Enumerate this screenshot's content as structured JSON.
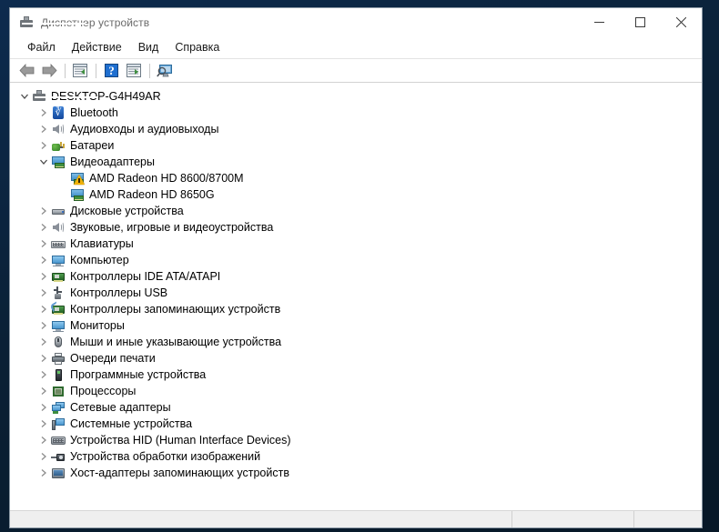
{
  "window": {
    "title": "Диспетчер устройств",
    "title_icon": "device-manager-icon",
    "controls": {
      "minimize": "minimize-icon",
      "maximize": "maximize-icon",
      "close": "close-icon"
    }
  },
  "menubar": {
    "items": [
      {
        "label": "Файл"
      },
      {
        "label": "Действие"
      },
      {
        "label": "Вид"
      },
      {
        "label": "Справка"
      }
    ]
  },
  "toolbar": {
    "items": [
      {
        "name": "back-button",
        "icon": "arrow-left-icon"
      },
      {
        "name": "forward-button",
        "icon": "arrow-right-icon"
      },
      {
        "name": "separator-1",
        "icon": "separator"
      },
      {
        "name": "show-hide-console-tree-button",
        "icon": "window-list-icon"
      },
      {
        "name": "separator-2",
        "icon": "separator"
      },
      {
        "name": "help-button",
        "icon": "question-mark-icon"
      },
      {
        "name": "properties-button",
        "icon": "window-properties-icon"
      },
      {
        "name": "separator-3",
        "icon": "separator"
      },
      {
        "name": "scan-for-hardware-changes-button",
        "icon": "monitor-search-icon"
      }
    ]
  },
  "tree": {
    "nodes": [
      {
        "label": "DESKTOP-G4H49AR",
        "depth": 0,
        "expander": "expanded",
        "icon": "computer-icon"
      },
      {
        "label": "Bluetooth",
        "depth": 1,
        "expander": "collapsed",
        "icon": "bluetooth-icon"
      },
      {
        "label": "Аудиовходы и аудиовыходы",
        "depth": 1,
        "expander": "collapsed",
        "icon": "speaker-icon"
      },
      {
        "label": "Батареи",
        "depth": 1,
        "expander": "collapsed",
        "icon": "battery-icon"
      },
      {
        "label": "Видеоадаптеры",
        "depth": 1,
        "expander": "expanded",
        "icon": "display-adapter-icon"
      },
      {
        "label": "AMD Radeon HD 8600/8700M",
        "depth": 2,
        "expander": "none",
        "icon": "display-adapter-warning-icon"
      },
      {
        "label": "AMD Radeon HD 8650G",
        "depth": 2,
        "expander": "none",
        "icon": "display-adapter-icon"
      },
      {
        "label": "Дисковые устройства",
        "depth": 1,
        "expander": "collapsed",
        "icon": "disk-drive-icon"
      },
      {
        "label": "Звуковые, игровые и видеоустройства",
        "depth": 1,
        "expander": "collapsed",
        "icon": "speaker-icon"
      },
      {
        "label": "Клавиатуры",
        "depth": 1,
        "expander": "collapsed",
        "icon": "keyboard-icon"
      },
      {
        "label": "Компьютер",
        "depth": 1,
        "expander": "collapsed",
        "icon": "monitor-icon"
      },
      {
        "label": "Контроллеры IDE ATA/ATAPI",
        "depth": 1,
        "expander": "collapsed",
        "icon": "ide-controller-icon"
      },
      {
        "label": "Контроллеры USB",
        "depth": 1,
        "expander": "collapsed",
        "icon": "usb-icon"
      },
      {
        "label": "Контроллеры запоминающих устройств",
        "depth": 1,
        "expander": "collapsed",
        "icon": "storage-controller-icon"
      },
      {
        "label": "Мониторы",
        "depth": 1,
        "expander": "collapsed",
        "icon": "monitor-icon"
      },
      {
        "label": "Мыши и иные указывающие устройства",
        "depth": 1,
        "expander": "collapsed",
        "icon": "mouse-icon"
      },
      {
        "label": "Очереди печати",
        "depth": 1,
        "expander": "collapsed",
        "icon": "printer-icon"
      },
      {
        "label": "Программные устройства",
        "depth": 1,
        "expander": "collapsed",
        "icon": "software-device-icon"
      },
      {
        "label": "Процессоры",
        "depth": 1,
        "expander": "collapsed",
        "icon": "cpu-icon"
      },
      {
        "label": "Сетевые адаптеры",
        "depth": 1,
        "expander": "collapsed",
        "icon": "network-adapter-icon"
      },
      {
        "label": "Системные устройства",
        "depth": 1,
        "expander": "collapsed",
        "icon": "system-device-icon"
      },
      {
        "label": "Устройства HID (Human Interface Devices)",
        "depth": 1,
        "expander": "collapsed",
        "icon": "hid-device-icon"
      },
      {
        "label": "Устройства обработки изображений",
        "depth": 1,
        "expander": "collapsed",
        "icon": "imaging-device-icon"
      },
      {
        "label": "Хост-адаптеры запоминающих устройств",
        "depth": 1,
        "expander": "collapsed",
        "icon": "host-adapter-icon"
      }
    ]
  },
  "statusbar": {
    "pane1": "",
    "pane2": "",
    "pane3": ""
  },
  "colors": {
    "accent_blue": "#3f8fc9",
    "warning_yellow": "#f0b10a",
    "bluetooth_blue": "#14489c",
    "green_card": "#3f8f3f",
    "desktop_navy": "#0a2035"
  }
}
